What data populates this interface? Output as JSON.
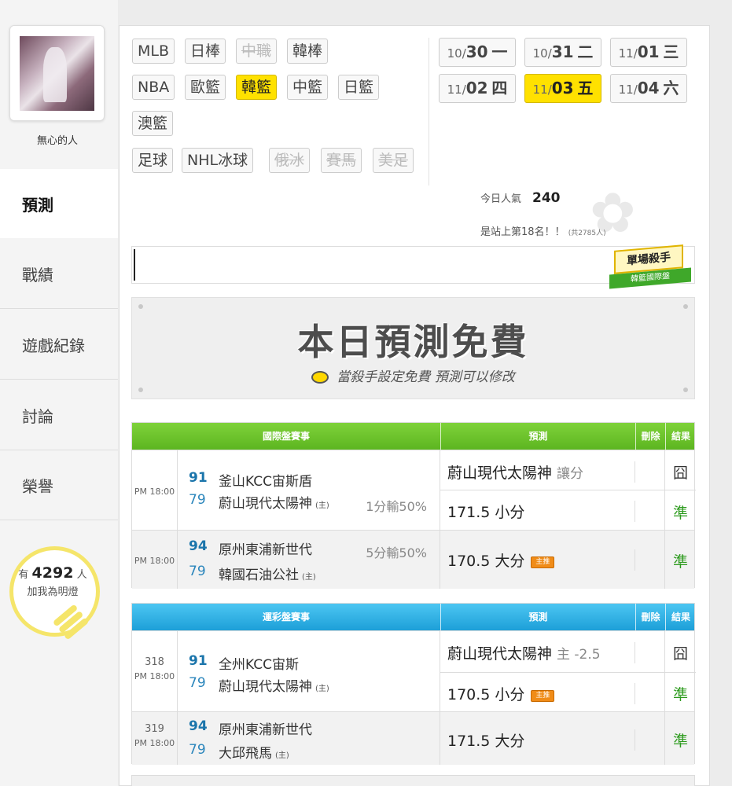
{
  "user": {
    "name": "無心的人"
  },
  "nav": [
    {
      "label": "預測"
    },
    {
      "label": "戰績"
    },
    {
      "label": "遊戲紀錄"
    },
    {
      "label": "討論"
    },
    {
      "label": "榮譽"
    }
  ],
  "followers": {
    "prefix": "有",
    "count": "4292",
    "unit": "人",
    "action": "加我為明燈"
  },
  "sports": {
    "row1": [
      "MLB",
      "日棒",
      "中職",
      "韓棒"
    ],
    "row2": [
      "NBA",
      "歐籃",
      "韓籃",
      "中籃",
      "日籃"
    ],
    "row3": [
      "澳籃"
    ],
    "row4": [
      "足球",
      "NHL冰球",
      "俄冰",
      "賽馬",
      "美足"
    ]
  },
  "dates": [
    {
      "md": "10/",
      "day": "30",
      "wd": "一"
    },
    {
      "md": "10/",
      "day": "31",
      "wd": "二"
    },
    {
      "md": "11/",
      "day": "01",
      "wd": "三"
    },
    {
      "md": "11/",
      "day": "02",
      "wd": "四"
    },
    {
      "md": "11/",
      "day": "03",
      "wd": "五"
    },
    {
      "md": "11/",
      "day": "04",
      "wd": "六"
    }
  ],
  "stats": {
    "label": "今日人氣",
    "value": "240",
    "rank": "是站上第18名！！",
    "total": "(共2785人)"
  },
  "badge": {
    "title": "單場殺手",
    "subtitle": "韓籃國際盤"
  },
  "banner": {
    "title": "本日預測免費",
    "subtitle": "當殺手設定免費  預測可以修改"
  },
  "intl": {
    "header": {
      "title": "國際盤賽事",
      "predict": "預測",
      "delete": "刪除",
      "result": "結果"
    },
    "games": [
      {
        "time": "PM 18:00",
        "top": {
          "score": "91",
          "team": "釜山KCC宙斯盾"
        },
        "bottom": {
          "score": "79",
          "team": "蔚山現代太陽神",
          "home": "(主)"
        },
        "note": "1分輸50%",
        "preds": [
          {
            "text": "蔚山現代太陽神",
            "extra": "讓分",
            "result": "囧"
          },
          {
            "text": "171.5 小分",
            "result": "準"
          }
        ]
      },
      {
        "time": "PM 18:00",
        "top": {
          "score": "94",
          "team": "原州東浦新世代"
        },
        "bottom": {
          "score": "79",
          "team": "韓國石油公社",
          "home": "(主)"
        },
        "note": "5分輸50%",
        "preds": [
          {
            "text": "170.5 大分",
            "tag": "主推",
            "result": "準"
          }
        ]
      }
    ]
  },
  "lottery": {
    "header": {
      "title": "運彩盤賽事",
      "predict": "預測",
      "delete": "刪除",
      "result": "結果"
    },
    "games": [
      {
        "num": "318",
        "time": "PM 18:00",
        "top": {
          "score": "91",
          "team": "全州KCC宙斯"
        },
        "bottom": {
          "score": "79",
          "team": "蔚山現代太陽神",
          "home": "(主)"
        },
        "preds": [
          {
            "text": "蔚山現代太陽神",
            "extra": "主 -2.5",
            "result": "囧"
          },
          {
            "text": "170.5 小分",
            "tag": "主推",
            "result": "準"
          }
        ]
      },
      {
        "num": "319",
        "time": "PM 18:00",
        "top": {
          "score": "94",
          "team": "原州東浦新世代"
        },
        "bottom": {
          "score": "79",
          "team": "大邱飛馬",
          "home": "(主)"
        },
        "preds": [
          {
            "text": "171.5 大分",
            "result": "準"
          }
        ]
      }
    ]
  },
  "colors": {
    "accent": "#ffe100",
    "green_header": "#5cb520",
    "blue_header": "#1d9fd8",
    "ok": "#2d9b1e"
  }
}
